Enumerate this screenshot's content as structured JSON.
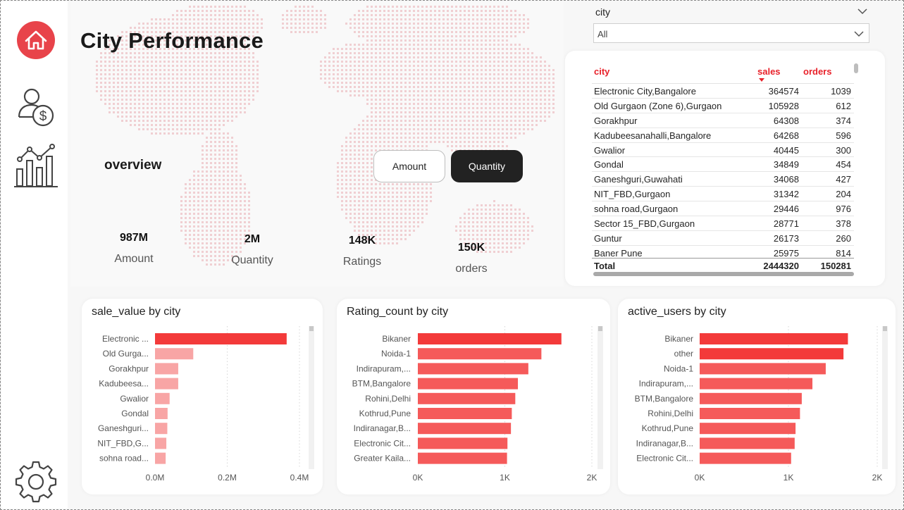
{
  "page": {
    "title": "City Performance",
    "overview_label": "overview"
  },
  "nav": {
    "items": [
      "home-icon",
      "sales-person-icon",
      "analytics-chart-icon",
      "settings-gear-icon"
    ],
    "accent": "#e8212a"
  },
  "toggles": {
    "amount_label": "Amount",
    "quantity_label": "Quantity",
    "active": "Quantity"
  },
  "kpis": [
    {
      "value": "987M",
      "label": "Amount"
    },
    {
      "value": "2M",
      "label": "Quantity"
    },
    {
      "value": "148K",
      "label": "Ratings"
    },
    {
      "value": "150K",
      "label": "orders"
    }
  ],
  "slicer": {
    "label": "city",
    "selected": "All"
  },
  "table": {
    "headers": {
      "city": "city",
      "sales": "sales",
      "orders": "orders"
    },
    "rows": [
      {
        "city": "Electronic City,Bangalore",
        "sales": "364574",
        "orders": "1039"
      },
      {
        "city": "Old Gurgaon (Zone 6),Gurgaon",
        "sales": "105928",
        "orders": "612"
      },
      {
        "city": "Gorakhpur",
        "sales": "64308",
        "orders": "374"
      },
      {
        "city": "Kadubeesanahalli,Bangalore",
        "sales": "64268",
        "orders": "596"
      },
      {
        "city": "Gwalior",
        "sales": "40445",
        "orders": "300"
      },
      {
        "city": "Gondal",
        "sales": "34849",
        "orders": "454"
      },
      {
        "city": "Ganeshguri,Guwahati",
        "sales": "34068",
        "orders": "427"
      },
      {
        "city": "NIT_FBD,Gurgaon",
        "sales": "31342",
        "orders": "204"
      },
      {
        "city": "sohna road,Gurgaon",
        "sales": "29446",
        "orders": "976"
      },
      {
        "city": "Sector 15_FBD,Gurgaon",
        "sales": "28771",
        "orders": "378"
      },
      {
        "city": "Guntur",
        "sales": "26173",
        "orders": "260"
      },
      {
        "city": "Baner Pune",
        "sales": "25975",
        "orders": "814"
      }
    ],
    "total": {
      "label": "Total",
      "sales": "2444320",
      "orders": "150281"
    }
  },
  "chart_data": [
    {
      "type": "bar",
      "orientation": "horizontal",
      "title": "sale_value by city",
      "categories": [
        "Electronic ...",
        "Old Gurga...",
        "Gorakhpur",
        "Kadubeesa...",
        "Gwalior",
        "Gondal",
        "Ganeshguri...",
        "NIT_FBD,G...",
        "sohna road..."
      ],
      "values": [
        364574,
        105928,
        64308,
        64268,
        40445,
        34849,
        34068,
        31342,
        29446
      ],
      "xlim": [
        0,
        400000
      ],
      "ticks": [
        "0.0M",
        "0.2M",
        "0.4M"
      ],
      "tick_values": [
        0,
        200000,
        400000
      ],
      "colors": [
        "#f33a3a",
        "#f8a5a5",
        "#f8a5a5",
        "#f8a5a5",
        "#f8a5a5",
        "#f8a5a5",
        "#f8a5a5",
        "#f8a5a5",
        "#f8a5a5"
      ]
    },
    {
      "type": "bar",
      "orientation": "horizontal",
      "title": "Rating_count by city",
      "categories": [
        "Bikaner",
        "Noida-1",
        "Indirapuram,...",
        "BTM,Bangalore",
        "Rohini,Delhi",
        "Kothrud,Pune",
        "Indiranagar,B...",
        "Electronic Cit...",
        "Greater Kaila..."
      ],
      "values": [
        1650,
        1420,
        1270,
        1150,
        1120,
        1080,
        1070,
        1030,
        1025
      ],
      "xlim": [
        0,
        2000
      ],
      "ticks": [
        "0K",
        "1K",
        "2K"
      ],
      "tick_values": [
        0,
        1000,
        2000
      ],
      "colors": [
        "#f33a3a",
        "#f55a5a",
        "#f55a5a",
        "#f55a5a",
        "#f55a5a",
        "#f55a5a",
        "#f55a5a",
        "#f55a5a",
        "#f55a5a"
      ]
    },
    {
      "type": "bar",
      "orientation": "horizontal",
      "title": "active_users by city",
      "categories": [
        "Bikaner",
        "other",
        "Noida-1",
        "Indirapuram,...",
        "BTM,Bangalore",
        "Rohini,Delhi",
        "Kothrud,Pune",
        "Indiranagar,B...",
        "Electronic Cit..."
      ],
      "values": [
        1670,
        1620,
        1420,
        1270,
        1150,
        1130,
        1080,
        1070,
        1030
      ],
      "xlim": [
        0,
        2000
      ],
      "ticks": [
        "0K",
        "1K",
        "2K"
      ],
      "tick_values": [
        0,
        1000,
        2000
      ],
      "colors": [
        "#f33a3a",
        "#f33a3a",
        "#f55a5a",
        "#f55a5a",
        "#f55a5a",
        "#f55a5a",
        "#f55a5a",
        "#f55a5a",
        "#f55a5a"
      ]
    }
  ]
}
